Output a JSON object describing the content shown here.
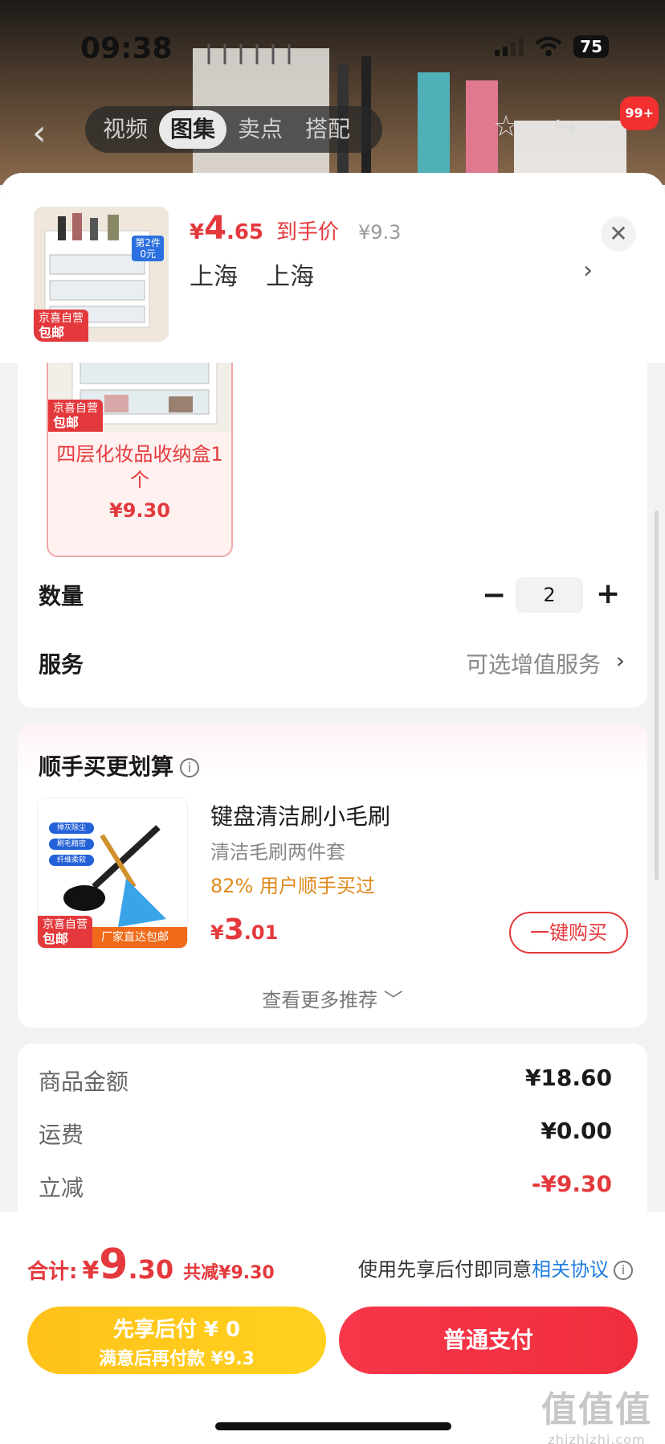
{
  "status": {
    "time": "09:38",
    "battery": "75"
  },
  "topnav": {
    "tabs": [
      {
        "label": "视频"
      },
      {
        "label": "图集"
      },
      {
        "label": "卖点"
      },
      {
        "label": "搭配"
      }
    ],
    "active_tab": "图集",
    "badge": "99+"
  },
  "header": {
    "price_symbol": "¥",
    "price_int": "4",
    "price_dec": ".65",
    "price_tag": "到手价",
    "orig_price": "¥9.3",
    "address": "上海  上海",
    "thumb_promo": "第2件\n0元",
    "thumb_tag": "京喜自营",
    "thumb_tag2": "包邮"
  },
  "sku": {
    "name": "四层化妆品收纳盒1个",
    "price": "¥9.30",
    "tag_line1": "京喜自营",
    "tag_line2": "包邮"
  },
  "quantity": {
    "label": "数量",
    "minus": "−",
    "value": "2",
    "plus": "+"
  },
  "service": {
    "label": "服务",
    "value": "可选增值服务"
  },
  "addon": {
    "title": "顺手买更划算",
    "info": "i",
    "product": {
      "name": "键盘清洁刷小毛刷",
      "subtitle": "清洁毛刷两件套",
      "stat": "82% 用户顺手买过",
      "price_symbol": "¥",
      "price_int": "3",
      "price_dec": ".01",
      "buy_label": "一键购买",
      "img_tags": [
        "掸灰除尘",
        "刷毛精密",
        "纤维柔软"
      ],
      "tag_line1": "京喜自营",
      "tag_line2": "包邮",
      "factory_tag": "厂家直达包邮"
    },
    "more_label": "查看更多推荐 ﹀"
  },
  "summary": [
    {
      "label": "商品金额",
      "value": "¥18.60",
      "red": false
    },
    {
      "label": "运费",
      "value": "¥0.00",
      "red": false
    },
    {
      "label": "立减",
      "value": "-¥9.30",
      "red": true
    }
  ],
  "bottom": {
    "total_label": "合计:",
    "total_symbol": "¥",
    "total_int": "9",
    "total_dec": ".30",
    "total_saving": "共减¥9.30",
    "agree_prefix": "使用先享后付即同意",
    "agree_link": "相关协议",
    "pay_later_line1": "先享后付 ¥ 0",
    "pay_later_line2": "满意后再付款 ¥9.3",
    "pay_normal": "普通支付"
  },
  "watermark": {
    "line1": "值值值",
    "line2": "zhizhizhi.com"
  },
  "colors": {
    "accent_red": "#e4393c",
    "pay_yellow": "#ffc21a",
    "link_blue": "#1f7de0",
    "stat_orange": "#e08a1e"
  }
}
